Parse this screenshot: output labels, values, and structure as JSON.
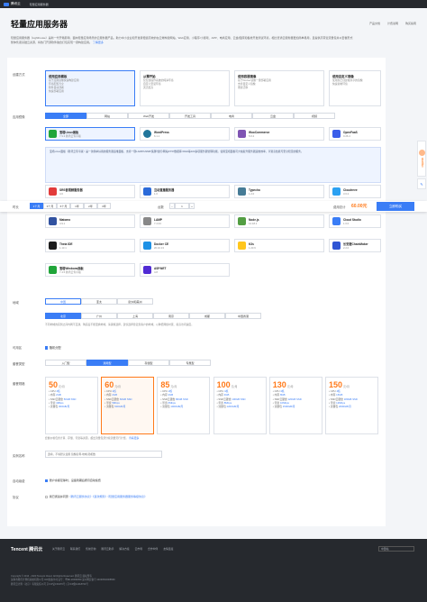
{
  "topbar": {
    "logo": "腾讯云",
    "nav": "轻量应用服务器"
  },
  "page": {
    "title": "轻量应用服务器",
    "links": [
      "产品文档",
      "计费说明",
      "购买指南"
    ],
    "desc": "轻量应用服务器（Lighthouse）是新一代开箱即用、面向轻量应用场景的云服务器产品，助力中小企业和开发者便捷高效的在云端构建网站、Web应用、小程序/小游戏、APP、电商应用、云盘/图床和各类开发测试环境，相比普通云服务器更加简单易用，且提供高带宽流量包并以套餐形式整体售卖基础云资源，将热门开源软件融合打包实现一键构建应用。",
    "desc_link": "了解更多"
  },
  "create_mode": {
    "label": "创建方式",
    "options": [
      {
        "title": "使用应用模板",
        "desc": "基于应用镜像快速构建应用",
        "points": [
          "环境配置齐全",
          "软件自动部署",
          "快速部署应用"
        ]
      },
      {
        "title": "从零开始",
        "desc": "仅包含操作系统的纯净环境",
        "points": [
          "自定义安装环境",
          "灵活度高"
        ]
      },
      {
        "title": "使用容器镜像",
        "desc": "基于Docker镜像一键部署应用",
        "points": [
          "支持自定义镜像",
          "便捷迁移"
        ]
      },
      {
        "title": "使用自定义镜像",
        "desc": "使用您已创建或共享的镜像",
        "points": [
          "快速复制环境"
        ]
      }
    ]
  },
  "image": {
    "label": "应用镜像",
    "tabs": [
      "全部",
      "网站",
      "Web开发",
      "开发工具",
      "电商",
      "云盘",
      "视频"
    ],
    "selected_tab": "全部",
    "notice": "宝塔Linux面板（腾讯云专享版）是一款简单好用的服务器运维面板，支持一键LAMP/LNMP/集群/监控/网站/FTP/数据库/JAVA等100多项服务器管理功能。使用宝塔面板可大幅提升服务器运维效率，享受高性能与安全稳定的服务。",
    "items": [
      {
        "name": "宝塔Linux面板",
        "ver": "7.9.3 腾讯云专享版",
        "color": "#20a53a",
        "badge": "推荐"
      },
      {
        "name": "WordPress",
        "ver": "6.1.1",
        "color": "#21759b"
      },
      {
        "name": "WooCommerce",
        "ver": "5.6.2",
        "color": "#7f54b3"
      },
      {
        "name": "OpenFaaS",
        "ver": "0.26.4",
        "color": "#3b5ee9"
      },
      {
        "name": "SRS音视频服务器",
        "ver": "4.0",
        "color": "#e23b3b"
      },
      {
        "name": "互动直播服务器",
        "ver": "1.0",
        "color": "#2b6ad9"
      },
      {
        "name": "Typecho",
        "ver": "1.2.0",
        "color": "#467b96"
      },
      {
        "name": "Cloudreve",
        "ver": "3.6.2",
        "color": "#2ba1f2"
      },
      {
        "name": "Matomo",
        "ver": "4.9.1",
        "color": "#3152a0"
      },
      {
        "name": "LAMP",
        "ver": "7.4.33",
        "color": "#888888"
      },
      {
        "name": "Node.js",
        "ver": "14.18.1",
        "color": "#539e43"
      },
      {
        "name": "Cloud Studio",
        "ver": "1.0.0",
        "color": "#3a7df6"
      },
      {
        "name": "Theia IDE",
        "ver": "1.13.1",
        "color": "#1d1d1d"
      },
      {
        "name": "Docker CE",
        "ver": "20.10.13",
        "color": "#1d91e6"
      },
      {
        "name": "K3s",
        "ver": "1.23.6",
        "color": "#ffc61c"
      },
      {
        "name": "长安链ChainMaker",
        "ver": "2.2.0",
        "color": "#2f55d4"
      },
      {
        "name": "宝塔Windows面板",
        "ver": "7.4.5 腾讯云专享版",
        "color": "#20a53a"
      },
      {
        "name": "ASP.NET",
        "ver": "4.8",
        "color": "#512bd4"
      }
    ]
  },
  "duration_bar": {
    "label": "时长",
    "options": [
      "1个月",
      "3个月",
      "6个月",
      "1年",
      "2年",
      "3年"
    ],
    "selected": "1个月",
    "qty_label": "台数",
    "qty": "1",
    "price_label": "费用总计",
    "price": "60.00元",
    "buy_button": "立即购买"
  },
  "region": {
    "label": "地域",
    "areas": [
      "中国",
      "亚太",
      "欧洲和美洲"
    ],
    "selected_area": "中国",
    "cities": [
      "北京",
      "广州",
      "上海",
      "南京",
      "成都",
      "中国香港"
    ],
    "selected_city": "北京",
    "note": "不同地域的实例之间内网不互通，购买后不能更换地域，请谨慎选择。建议选择靠近您客户的地域，以降低网络时延、提高访问速度。"
  },
  "availability": {
    "label": "可用区",
    "option": "随机分配"
  },
  "pkg_type": {
    "label": "套餐类型",
    "options": [
      "入门型",
      "通用型",
      "存储型",
      "专属型"
    ],
    "selected": "通用型"
  },
  "packages": {
    "label": "套餐规格",
    "unit": "元/月",
    "items": [
      {
        "price": "50",
        "cpu": "2核",
        "mem": "2GB",
        "disk": "50GB SSD",
        "bw": "4Mbps",
        "traffic": "300GB/月"
      },
      {
        "price": "60",
        "cpu": "2核",
        "mem": "2GB",
        "disk": "60GB SSD",
        "bw": "5Mbps",
        "traffic": "500GB/月"
      },
      {
        "price": "85",
        "cpu": "2核",
        "mem": "4GB",
        "disk": "80GB SSD",
        "bw": "6Mbps",
        "traffic": "1000GB/月"
      },
      {
        "price": "100",
        "cpu": "4核",
        "mem": "4GB",
        "disk": "100GB SSD",
        "bw": "8Mbps",
        "traffic": "1200GB/月"
      },
      {
        "price": "130",
        "cpu": "4核",
        "mem": "8GB",
        "disk": "120GB SSD",
        "bw": "10Mbps",
        "traffic": "1500GB/月"
      },
      {
        "price": "150",
        "cpu": "4核",
        "mem": "16GB",
        "disk": "180GB SSD",
        "bw": "12Mbps",
        "traffic": "2000GB/月"
      }
    ],
    "selected_index": 1,
    "row_labels": [
      "CPU",
      "内存",
      "SSD云硬盘",
      "带宽",
      "流量包"
    ],
    "note": "套餐价格包含计算、存储、带宽等资源，超出流量包部分按流量另行计费。",
    "note_link": "查看更多"
  },
  "instance_name": {
    "label": "实例名称",
    "placeholder": "选填，不填默认使用 镜像名称-地域-随机数"
  },
  "auto_renew": {
    "label": "自动续费",
    "text": "账户余额足够时，设备到期后按月自动续费"
  },
  "agreement": {
    "label": "协议",
    "text": "我已阅读并同意",
    "link1": "《腾讯云服务协议》",
    "link2": "《退款规则》",
    "link3": "《轻量应用服务器服务等级协议》"
  },
  "footer": {
    "brand": "Tencent 腾讯云",
    "links": [
      "关于腾讯云",
      "联系我们",
      "售前咨询",
      "腾讯云助手",
      "解决方案",
      "云市场",
      "合作伙伴",
      "友情链接"
    ],
    "lines": [
      "Copyright © 2013 - 2023 Tencent Cloud. All Rights Reserved. 腾讯云 版权所有",
      "深圳市腾讯计算机系统有限公司 ICP备案/许可证号：粤B2-20090059 深公网安备号 44030502008569",
      "腾讯云计算（北京）有限责任公司 京ICP证150476号 | 京ICP备11018762号"
    ],
    "lang": "中国站"
  },
  "side_float": [
    "联系销售",
    "建议反馈"
  ]
}
